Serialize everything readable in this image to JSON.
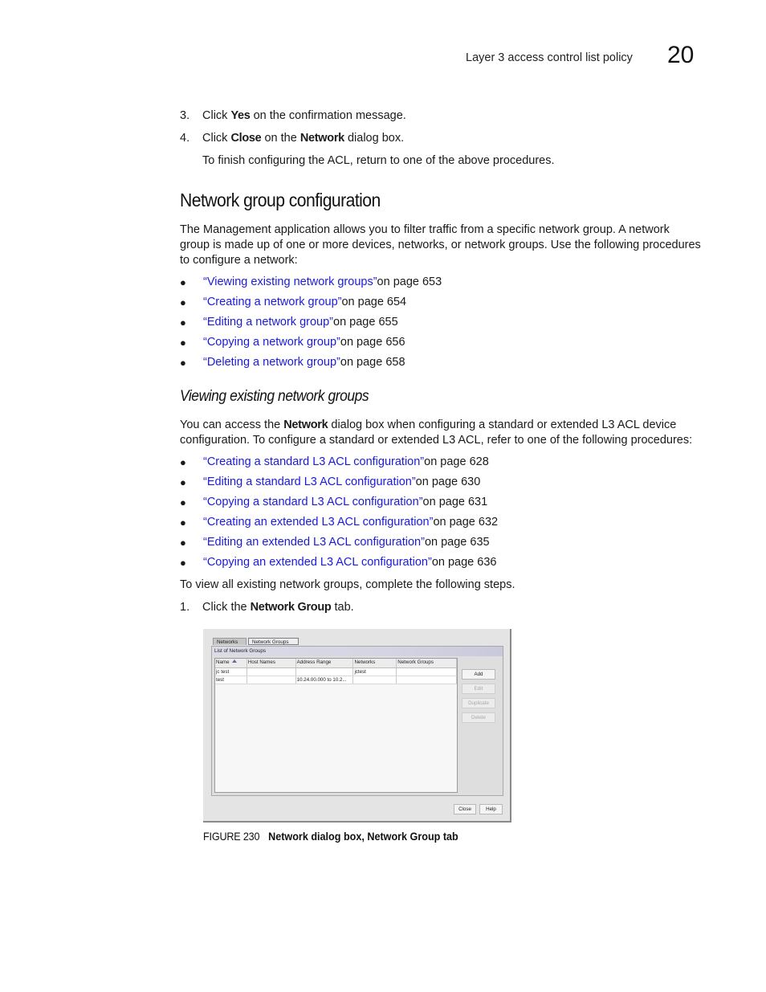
{
  "header": {
    "running_title": "Layer 3 access control list policy",
    "chapter_number": "20"
  },
  "intro_steps": [
    {
      "number": "3.",
      "pre": "Click ",
      "bold": "Yes",
      "post": " on the confirmation message."
    },
    {
      "number": "4.",
      "pre": "Click ",
      "bold": "Close",
      "mid": " on the ",
      "bold2": "Network",
      "post": " dialog box."
    }
  ],
  "intro_note": "To finish configuring the ACL, return to one of the above procedures.",
  "section": {
    "title": "Network group configuration",
    "paragraph": "The Management application allows you to filter traffic from a specific network group. A network group is made up of one or more devices, networks, or network groups. Use the following procedures to configure a network:",
    "links": [
      {
        "text": "“Viewing existing network groups”",
        "suffix": " on page 653"
      },
      {
        "text": "“Creating a network group”",
        "suffix": " on page 654"
      },
      {
        "text": "“Editing a network group”",
        "suffix": " on page 655"
      },
      {
        "text": "“Copying a network group”",
        "suffix": " on page 656"
      },
      {
        "text": "“Deleting a network group”",
        "suffix": " on page 658"
      }
    ]
  },
  "subsection": {
    "title": "Viewing existing network groups",
    "paragraph_pre": "You can access the ",
    "paragraph_bold": "Network",
    "paragraph_post": " dialog box when configuring a standard or extended L3 ACL device configuration. To configure a standard or extended L3 ACL, refer to one of the following procedures:",
    "links": [
      {
        "text": "“Creating a standard L3 ACL configuration”",
        "suffix": " on page 628"
      },
      {
        "text": "“Editing a standard L3 ACL configuration”",
        "suffix": " on page 630"
      },
      {
        "text": "“Copying a standard L3 ACL configuration”",
        "suffix": " on page 631"
      },
      {
        "text": "“Creating an extended L3 ACL configuration”",
        "suffix": " on page 632"
      },
      {
        "text": "“Editing an extended L3 ACL configuration”",
        "suffix": " on page 635"
      },
      {
        "text": "“Copying an extended L3 ACL configuration”",
        "suffix": " on page 636"
      }
    ],
    "steps_intro": "To view all existing network groups, complete the following steps.",
    "step1": {
      "number": "1.",
      "pre": "Click the ",
      "bold": "Network Group",
      "post": " tab."
    }
  },
  "dialog": {
    "tabs": [
      "Networks",
      "Network Groups"
    ],
    "active_tab": "Network Groups",
    "panel_title": "List of Network Groups",
    "columns": [
      "Name",
      "Host Names",
      "Address Range",
      "Networks",
      "Network Groups"
    ],
    "sort_column": "Name",
    "rows": [
      [
        "jc test",
        "",
        "",
        "jctest",
        ""
      ],
      [
        "test",
        "",
        "10.24.00.000 to 10.2...",
        "",
        ""
      ]
    ],
    "side_buttons": [
      {
        "label": "Add",
        "enabled": true
      },
      {
        "label": "Edit",
        "enabled": false
      },
      {
        "label": "Duplicate",
        "enabled": false
      },
      {
        "label": "Delete",
        "enabled": false
      }
    ],
    "footer_buttons": [
      "Close",
      "Help"
    ]
  },
  "figure": {
    "number": "FIGURE 230",
    "title": "Network dialog box, Network Group tab"
  }
}
